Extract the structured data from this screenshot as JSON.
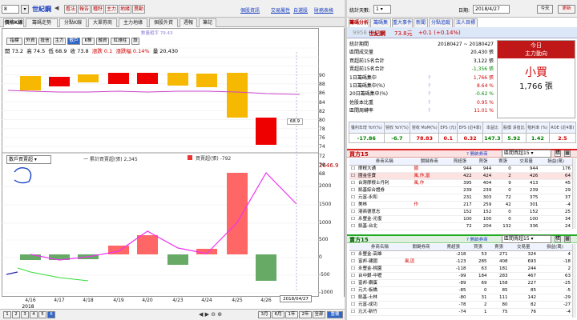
{
  "topbar": {
    "stock_code": "8",
    "stock_name": "世紀鋼",
    "tabs": [
      "看法",
      "報告",
      "種籽",
      "主力",
      "地緣",
      "異動"
    ],
    "links": [
      "個股資訊",
      "交易屬性",
      "自選股",
      "財務表格"
    ]
  },
  "chart_tabs": [
    "價格K線",
    "籌碼走勢",
    "分點K線",
    "大單券商",
    "主力地緣",
    "個股外資",
    "週報",
    "筆記"
  ],
  "toolbar": {
    "buttons": [
      "指標",
      "外資",
      "投信",
      "主力",
      "散戶",
      "K棒",
      "融資",
      "紅綠柱"
    ],
    "active": "散戶",
    "legend": "數量粗字 79.43"
  },
  "price_info": {
    "open_label": "開",
    "open": "73.2",
    "high_label": "高",
    "high": "74.5",
    "low_label": "低",
    "low": "68.9",
    "close_label": "收",
    "close": "73.8",
    "change": "漲跌 0.1",
    "pct": "漲跌幅 0.14%",
    "vol": "量 20,430"
  },
  "main_chart": {
    "y_ticks": [
      "90",
      "88",
      "86",
      "84",
      "82",
      "80",
      "78",
      "76",
      "74",
      "72",
      "70",
      "68"
    ],
    "current_label": "68.9"
  },
  "lower_panel": {
    "select": "散戶買賣超",
    "legend1": "一 累計買賣超(張) 2,345",
    "legend2": "買賣超(張) -792",
    "top_value": "2646.9",
    "y_ticks": [
      "2000",
      "1500",
      "1000",
      "500",
      "0",
      "-500",
      "-1000"
    ]
  },
  "x_ticks": [
    "4/16",
    "4/17",
    "4/18",
    "4/19",
    "4/20",
    "4/23",
    "4/24",
    "4/25",
    "4/26"
  ],
  "x_year": "2018",
  "x_cursor": "2018/04/27",
  "footer": {
    "pages": [
      "1",
      "2",
      "3",
      "4",
      "5",
      "6"
    ],
    "periods": [
      "3月",
      "6月",
      "1年",
      "2年",
      "全部"
    ],
    "confirm": "重覆"
  },
  "right_top": {
    "period_label": "統計天數:",
    "period_value": "1",
    "date_label": "日期:",
    "date_value": "2018/4/27",
    "today": "今天",
    "refresh": "更新"
  },
  "right_tabs": [
    "籌碼分析",
    "籌碼集",
    "重大事件",
    "新聞",
    "分點追蹤",
    "法人目標"
  ],
  "stock_header": {
    "code": "9958",
    "name": "世紀鋼",
    "price": "73.8元",
    "change": "+0.1 (+0.14%)"
  },
  "stats": [
    {
      "label": "統計期間",
      "value": "20180427 ~ 20180427",
      "q": ""
    },
    {
      "label": "區間成交量",
      "value": "20,430 張",
      "q": ""
    },
    {
      "label": "買超前15名合計",
      "value": "3,122 張",
      "q": ""
    },
    {
      "label": "賣超前15名合計",
      "value": "-1,356 張",
      "q": ""
    },
    {
      "label": "1日籌碼集中",
      "value": "1,766 張",
      "q": "?"
    },
    {
      "label": "1日籌碼集中(%)",
      "value": "8.64 %",
      "q": "?"
    },
    {
      "label": "20日籌碼集中(%)",
      "value": "-0.62 %",
      "q": "?"
    },
    {
      "label": "佐股本比重",
      "value": "0.95 %",
      "q": "?"
    },
    {
      "label": "區間周轉率",
      "value": "11.01 %",
      "q": "?"
    }
  ],
  "today_box": {
    "line1": "今日",
    "line2": "主力動向",
    "action": "小買",
    "amount": "1,766 張"
  },
  "metrics": {
    "headers": [
      "獲利年增 YoY(%)",
      "營收 YoY(%)",
      "營收 MoM(%)",
      "EPS (元)",
      "EPS (近4季)",
      "本益比",
      "股價 淨值比",
      "殖利率 (%)",
      "ROE (近4季)"
    ],
    "values": [
      "-17.86",
      "-6.7",
      "78.83",
      "0.1",
      "0.32",
      "147.3",
      "5.92",
      "1.42",
      "2.5"
    ],
    "colors": [
      "#008000",
      "#008000",
      "#d00000",
      "#d00000",
      "#d00000",
      "#008000",
      "#008000",
      "#008000",
      "#d00000"
    ]
  },
  "buy_table": {
    "title": "買方15",
    "query": "開啟券商",
    "select": "區間買超15",
    "cols": [
      "券商名稱",
      "關鍵券商",
      "買超張",
      "買張",
      "賣張",
      "交易量",
      "損益(萬)"
    ],
    "rows": [
      [
        "摩根大通",
        "國",
        "944",
        "944",
        "0",
        "944",
        "176"
      ],
      [
        "國金佳寶",
        "風,作,富",
        "422",
        "424",
        "2",
        "426",
        "64"
      ],
      [
        "台灣摩根士丹利",
        "風,作",
        "395",
        "404",
        "9",
        "413",
        "45"
      ],
      [
        "凱基綜合證券",
        "",
        "239",
        "239",
        "0",
        "239",
        "29"
      ],
      [
        "元富-永和",
        "",
        "231",
        "303",
        "72",
        "375",
        "37"
      ],
      [
        "美林",
        "作",
        "217",
        "259",
        "42",
        "301",
        "-4"
      ],
      [
        "港商德意志",
        "",
        "152",
        "152",
        "0",
        "152",
        "25"
      ],
      [
        "永豐金-光復",
        "",
        "100",
        "100",
        "0",
        "100",
        "34"
      ],
      [
        "凱基-台北",
        "",
        "72",
        "204",
        "132",
        "336",
        "24"
      ]
    ]
  },
  "sell_table": {
    "title": "賣方15",
    "query": "開啟券商",
    "select": "區間賣超15",
    "cols": [
      "券商名稱",
      "關鍵券商",
      "賣超張",
      "買張",
      "賣張",
      "交易量",
      "損益(萬)"
    ],
    "rows": [
      [
        "永豐金-高雄",
        "",
        "-218",
        "53",
        "271",
        "324",
        "4"
      ],
      [
        "富邦-建國",
        "風,區",
        "-123",
        "285",
        "408",
        "693",
        "-18"
      ],
      [
        "永豐金-桃園",
        "",
        "-118",
        "63",
        "181",
        "244",
        "2"
      ],
      [
        "台中銀-中壢",
        "",
        "-99",
        "184",
        "283",
        "467",
        "63"
      ],
      [
        "富邦-鑽蛋",
        "",
        "-89",
        "69",
        "158",
        "227",
        "-25"
      ],
      [
        "元大-板橋",
        "",
        "-85",
        "0",
        "85",
        "85",
        "-5"
      ],
      [
        "凱基-士林",
        "",
        "-80",
        "31",
        "111",
        "142",
        "-29"
      ],
      [
        "元富-成功",
        "",
        "-78",
        "2",
        "80",
        "82",
        "-27"
      ],
      [
        "元大-新竹",
        "",
        "-74",
        "1",
        "75",
        "76",
        "-4"
      ]
    ]
  }
}
